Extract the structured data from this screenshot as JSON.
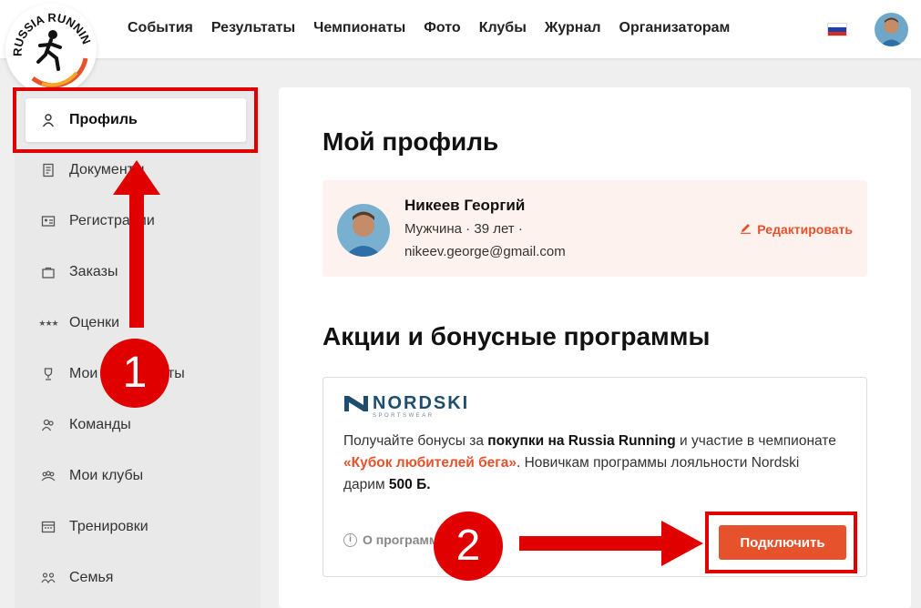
{
  "header": {
    "logo_text": "RUSSIA RUNNING",
    "nav": [
      "События",
      "Результаты",
      "Чемпионаты",
      "Фото",
      "Клубы",
      "Журнал",
      "Организаторам"
    ]
  },
  "sidebar": {
    "items": [
      {
        "label": "Профиль",
        "icon": "user-icon"
      },
      {
        "label": "Документы",
        "icon": "document-icon"
      },
      {
        "label": "Регистрации",
        "icon": "id-card-icon"
      },
      {
        "label": "Заказы",
        "icon": "bag-icon"
      },
      {
        "label": "Оценки",
        "icon": "stars-icon"
      },
      {
        "label": "Мои чемпионаты",
        "icon": "trophy-icon"
      },
      {
        "label": "Команды",
        "icon": "team-icon"
      },
      {
        "label": "Мои клубы",
        "icon": "clubs-icon"
      },
      {
        "label": "Тренировки",
        "icon": "calendar-icon"
      },
      {
        "label": "Семья",
        "icon": "family-icon"
      }
    ]
  },
  "main": {
    "title": "Мой профиль",
    "profile": {
      "name": "Никеев Георгий",
      "details": "Мужчина · 39 лет ·",
      "email": "nikeev.george@gmail.com",
      "edit_label": "Редактировать"
    },
    "promos_title": "Акции и бонусные программы",
    "promo": {
      "brand": "NORDSKI",
      "brand_sub": "SPORTSWEAR",
      "text_1": "Получайте бонусы за ",
      "text_bold_1": "покупки на Russia Running",
      "text_2": " и участие в чемпионате ",
      "text_highlight": "«Кубок любителей бега»",
      "text_3": ". Новичкам программы лояльности Nordski дарим ",
      "text_bold_2": "500 Б.",
      "about_label": "О программе",
      "connect_label": "Подключить"
    }
  },
  "annotations": {
    "step1": "1",
    "step2": "2"
  },
  "colors": {
    "accent": "#e6522c",
    "annotation": "#e00000",
    "brand_blue": "#1e4e6e"
  }
}
